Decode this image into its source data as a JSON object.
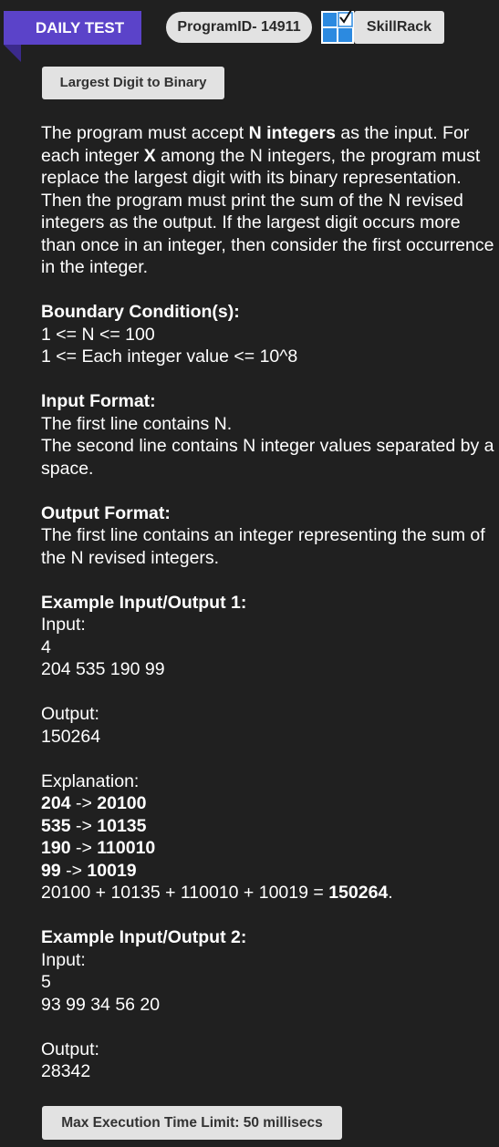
{
  "header": {
    "ribbon_label": "DAILY TEST",
    "program_id": "ProgramID- 14911",
    "brand_label": "SkillRack",
    "logo_icon": "skillrack-logo-icon",
    "colors": {
      "ribbon": "#5b43c9",
      "logo_blue": "#2c8ae0",
      "background": "#202020",
      "button": "#e2e2e2"
    }
  },
  "problem": {
    "title": "Largest Digit to Binary",
    "description": {
      "part1": "The program must accept ",
      "bold1": "N integers",
      "part2": " as the input. For each integer ",
      "bold2": "X",
      "part3": " among the N integers, the program must replace the largest digit with its binary representation. Then the program must print the sum of the N revised integers as the output. If the largest digit occurs more than once in an integer, then consider the first occurrence in the integer."
    },
    "boundary": {
      "heading": "Boundary Condition(s):",
      "lines": [
        "1 <= N <= 100",
        "1 <= Each integer value <= 10^8"
      ]
    },
    "input_format": {
      "heading": "Input Format:",
      "lines": [
        "The first line contains N.",
        "The second line contains N integer values separated by a space."
      ]
    },
    "output_format": {
      "heading": "Output Format:",
      "lines": [
        "The first line contains an integer representing the sum of the N revised integers."
      ]
    },
    "example1": {
      "heading": "Example Input/Output 1:",
      "input_label": "Input:",
      "input_lines": [
        "4",
        "204 535 190 99"
      ],
      "output_label": "Output:",
      "output_value": "150264",
      "explanation_label": "Explanation:",
      "mappings": [
        {
          "from": "204",
          "arrow": " -> ",
          "to": "20100"
        },
        {
          "from": "535",
          "arrow": " -> ",
          "to": "10135"
        },
        {
          "from": "190",
          "arrow": " -> ",
          "to": "110010"
        },
        {
          "from": "99",
          "arrow": " -> ",
          "to": "10019"
        }
      ],
      "sum_expression": "20100 + 10135 + 110010 + 10019 = ",
      "sum_result": "150264",
      "sum_end": "."
    },
    "example2": {
      "heading": "Example Input/Output 2:",
      "input_label": "Input:",
      "input_lines": [
        "5",
        "93 99 34 56 20"
      ],
      "output_label": "Output:",
      "output_value": "28342"
    },
    "time_limit": "Max Execution Time Limit: 50 millisecs"
  }
}
